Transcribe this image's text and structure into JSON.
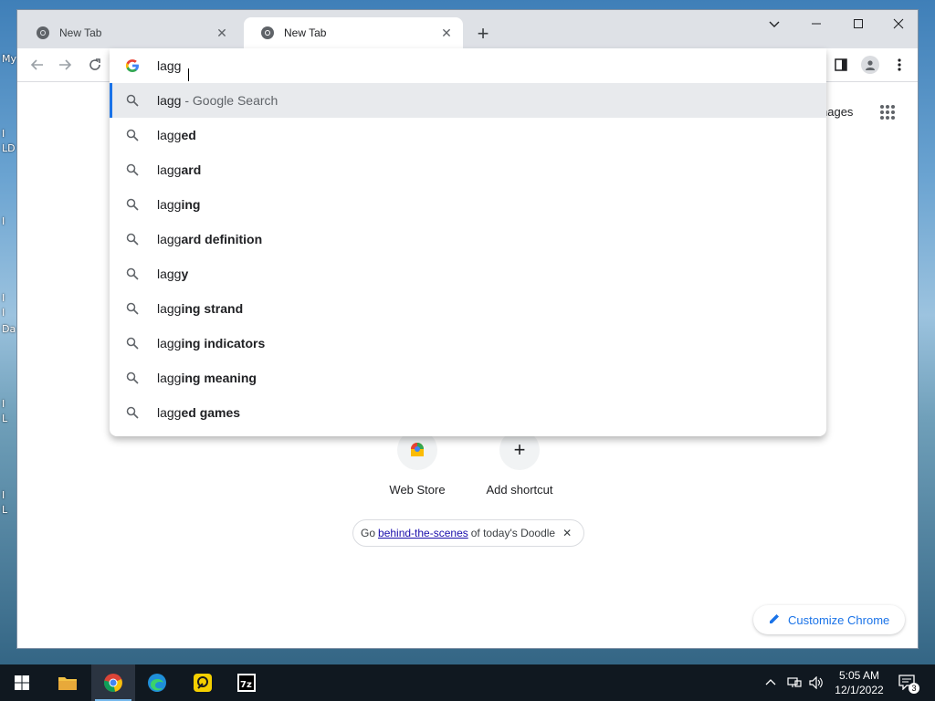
{
  "desktop": {
    "edge_labels": [
      "My",
      "I",
      "LD",
      "I",
      "I",
      "I",
      "Da",
      "I",
      "L",
      "I",
      "L"
    ]
  },
  "browser": {
    "tabs": [
      {
        "title": "New Tab",
        "active": false
      },
      {
        "title": "New Tab",
        "active": true
      }
    ],
    "new_tab_symbol": "+",
    "omnibox": {
      "value": "lagg",
      "suggestions": [
        {
          "prefix": "lagg",
          "bold": "",
          "suffix": " - Google Search",
          "selected": true
        },
        {
          "prefix": "lagg",
          "bold": "ed",
          "suffix": ""
        },
        {
          "prefix": "lagg",
          "bold": "ard",
          "suffix": ""
        },
        {
          "prefix": "lagg",
          "bold": "ing",
          "suffix": ""
        },
        {
          "prefix": "lagg",
          "bold": "ard definition",
          "suffix": ""
        },
        {
          "prefix": "lagg",
          "bold": "y",
          "suffix": ""
        },
        {
          "prefix": "lagg",
          "bold": "ing strand",
          "suffix": ""
        },
        {
          "prefix": "lagg",
          "bold": "ing indicators",
          "suffix": ""
        },
        {
          "prefix": "lagg",
          "bold": "ing meaning",
          "suffix": ""
        },
        {
          "prefix": "lagg",
          "bold": "ed games",
          "suffix": ""
        }
      ]
    }
  },
  "page": {
    "images_link": "nages",
    "shortcuts": [
      {
        "label": "Web Store"
      },
      {
        "label": "Add shortcut",
        "symbol": "+"
      }
    ],
    "doodle": {
      "before": "Go",
      "link": "behind-the-scenes",
      "after": "of today's Doodle"
    },
    "customize_label": "Customize Chrome"
  },
  "taskbar": {
    "time": "5:05 AM",
    "date": "12/1/2022",
    "notification_count": "3"
  },
  "colors": {
    "accent": "#1a73e8",
    "link": "#1a0dab",
    "taskbar": "#101820"
  }
}
